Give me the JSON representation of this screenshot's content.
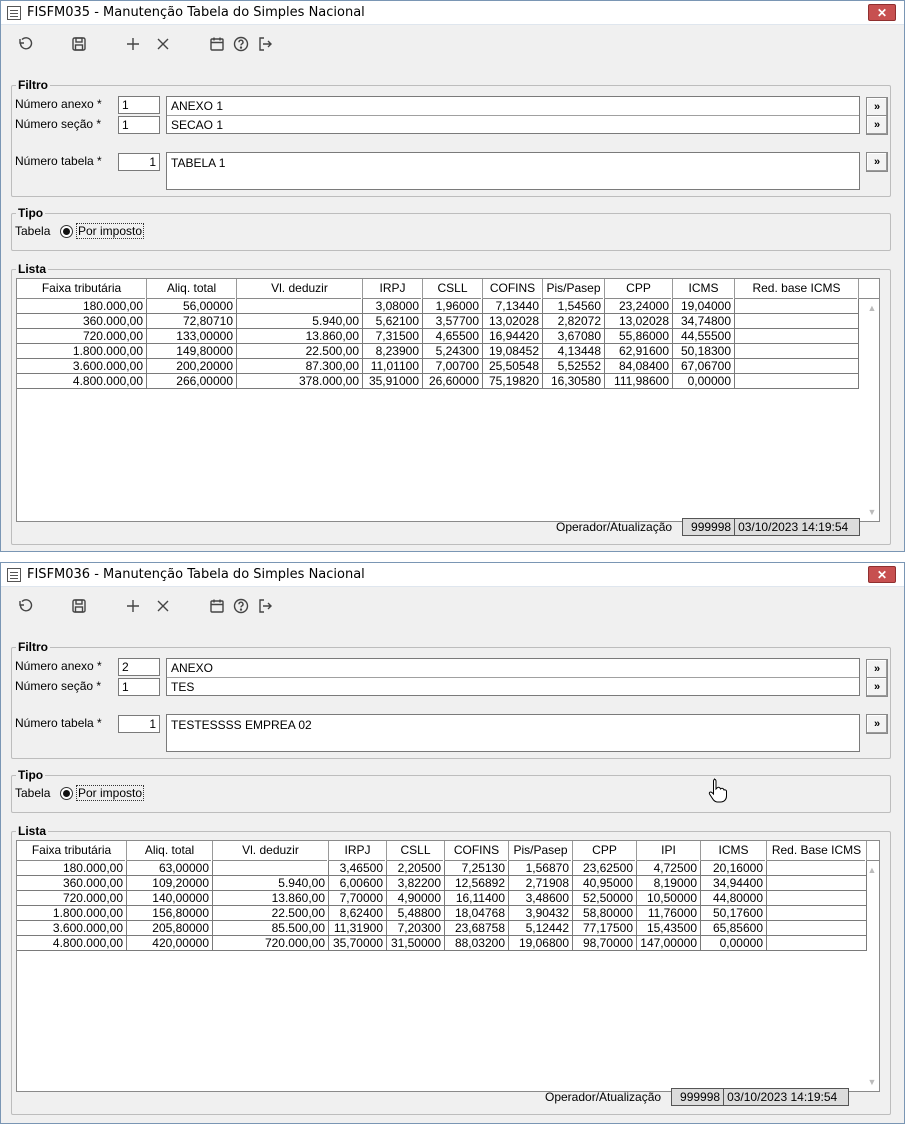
{
  "w1": {
    "title": "FISFM035 - Manutenção Tabela do Simples Nacional",
    "filter_title": "Filtro",
    "anexo_label": "Número anexo *",
    "anexo_value": "1",
    "anexo_desc": "ANEXO 1",
    "secao_label": "Número seção *",
    "secao_value": "1",
    "secao_desc": "SECAO 1",
    "tabela_label": "Número tabela *",
    "tabela_value": "1",
    "tabela_desc": "TABELA 1",
    "lookup_label": "»",
    "tipo_title": "Tipo",
    "tabela_tipo_label": "Tabela",
    "radio_label": "Por imposto",
    "lista_title": "Lista",
    "headers": [
      "Faixa tributária",
      "Aliq. total",
      "Vl. deduzir",
      "IRPJ",
      "CSLL",
      "COFINS",
      "Pis/Pasep",
      "CPP",
      "ICMS",
      "Red. base ICMS"
    ],
    "rows": [
      [
        "180.000,00",
        "56,00000",
        "",
        "3,08000",
        "1,96000",
        "7,13440",
        "1,54560",
        "23,24000",
        "19,04000",
        ""
      ],
      [
        "360.000,00",
        "72,80710",
        "5.940,00",
        "5,62100",
        "3,57700",
        "13,02028",
        "2,82072",
        "13,02028",
        "34,74800",
        ""
      ],
      [
        "720.000,00",
        "133,00000",
        "13.860,00",
        "7,31500",
        "4,65500",
        "16,94420",
        "3,67080",
        "55,86000",
        "44,55500",
        ""
      ],
      [
        "1.800.000,00",
        "149,80000",
        "22.500,00",
        "8,23900",
        "5,24300",
        "19,08452",
        "4,13448",
        "62,91600",
        "50,18300",
        ""
      ],
      [
        "3.600.000,00",
        "200,20000",
        "87.300,00",
        "11,01100",
        "7,00700",
        "25,50548",
        "5,52552",
        "84,08400",
        "67,06700",
        ""
      ],
      [
        "4.800.000,00",
        "266,00000",
        "378.000,00",
        "35,91000",
        "26,60000",
        "75,19820",
        "16,30580",
        "111,98600",
        "0,00000",
        ""
      ]
    ],
    "status_label": "Operador/Atualização",
    "status_operator": "999998",
    "status_datetime": "03/10/2023 14:19:54"
  },
  "w2": {
    "title": "FISFM036 - Manutenção Tabela do Simples Nacional",
    "filter_title": "Filtro",
    "anexo_label": "Número anexo *",
    "anexo_value": "2",
    "anexo_desc": "ANEXO",
    "secao_label": "Número seção *",
    "secao_value": "1",
    "secao_desc": "TES",
    "tabela_label": "Número tabela *",
    "tabela_value": "1",
    "tabela_desc": "TESTESSSS EMPREA 02",
    "lookup_label": "»",
    "tipo_title": "Tipo",
    "tabela_tipo_label": "Tabela",
    "radio_label": "Por imposto",
    "lista_title": "Lista",
    "headers": [
      "Faixa tributária",
      "Aliq. total",
      "Vl. deduzir",
      "IRPJ",
      "CSLL",
      "COFINS",
      "Pis/Pasep",
      "CPP",
      "IPI",
      "ICMS",
      "Red. Base ICMS"
    ],
    "rows": [
      [
        "180.000,00",
        "63,00000",
        "",
        "3,46500",
        "2,20500",
        "7,25130",
        "1,56870",
        "23,62500",
        "4,72500",
        "20,16000",
        ""
      ],
      [
        "360.000,00",
        "109,20000",
        "5.940,00",
        "6,00600",
        "3,82200",
        "12,56892",
        "2,71908",
        "40,95000",
        "8,19000",
        "34,94400",
        ""
      ],
      [
        "720.000,00",
        "140,00000",
        "13.860,00",
        "7,70000",
        "4,90000",
        "16,11400",
        "3,48600",
        "52,50000",
        "10,50000",
        "44,80000",
        ""
      ],
      [
        "1.800.000,00",
        "156,80000",
        "22.500,00",
        "8,62400",
        "5,48800",
        "18,04768",
        "3,90432",
        "58,80000",
        "11,76000",
        "50,17600",
        ""
      ],
      [
        "3.600.000,00",
        "205,80000",
        "85.500,00",
        "11,31900",
        "7,20300",
        "23,68758",
        "5,12442",
        "77,17500",
        "15,43500",
        "65,85600",
        ""
      ],
      [
        "4.800.000,00",
        "420,00000",
        "720.000,00",
        "35,70000",
        "31,50000",
        "88,03200",
        "19,06800",
        "98,70000",
        "147,00000",
        "0,00000",
        ""
      ]
    ],
    "status_label": "Operador/Atualização",
    "status_operator": "999998",
    "status_datetime": "03/10/2023 14:19:54"
  },
  "icons": {
    "toolbar": [
      "undo-icon",
      "save-icon",
      "add-icon",
      "delete-icon",
      "calendar-icon",
      "help-icon",
      "exit-icon"
    ],
    "close": "close-icon",
    "cursor": "hand-pointer-icon"
  },
  "colors": {
    "title_close": "#c75050",
    "window_bg": "#f0f0f0",
    "status_bg": "#dcdcdc"
  }
}
